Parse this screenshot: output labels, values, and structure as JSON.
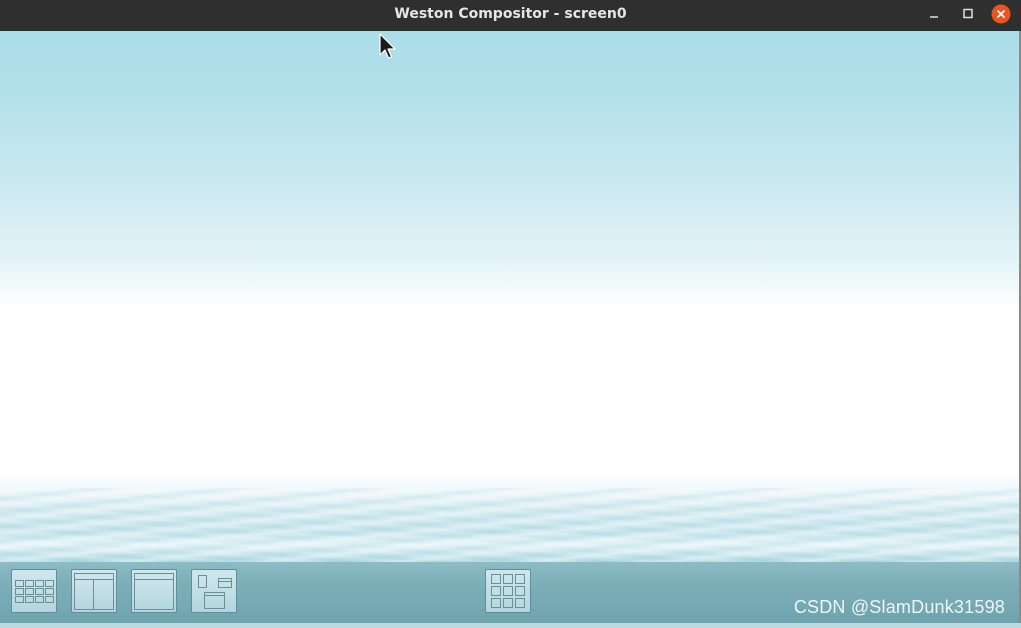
{
  "window": {
    "title": "Weston Compositor - screen0",
    "controls": [
      "minimize-icon",
      "maximize-icon",
      "close-icon"
    ],
    "close_color": "#e95420"
  },
  "panel": {
    "left_buttons": [
      "grid-layout-icon",
      "two-column-layout-icon",
      "single-window-layout-icon",
      "freeform-layout-icon"
    ],
    "center_button": "app-grid-icon"
  },
  "watermark": "CSDN @SlamDunk31598"
}
